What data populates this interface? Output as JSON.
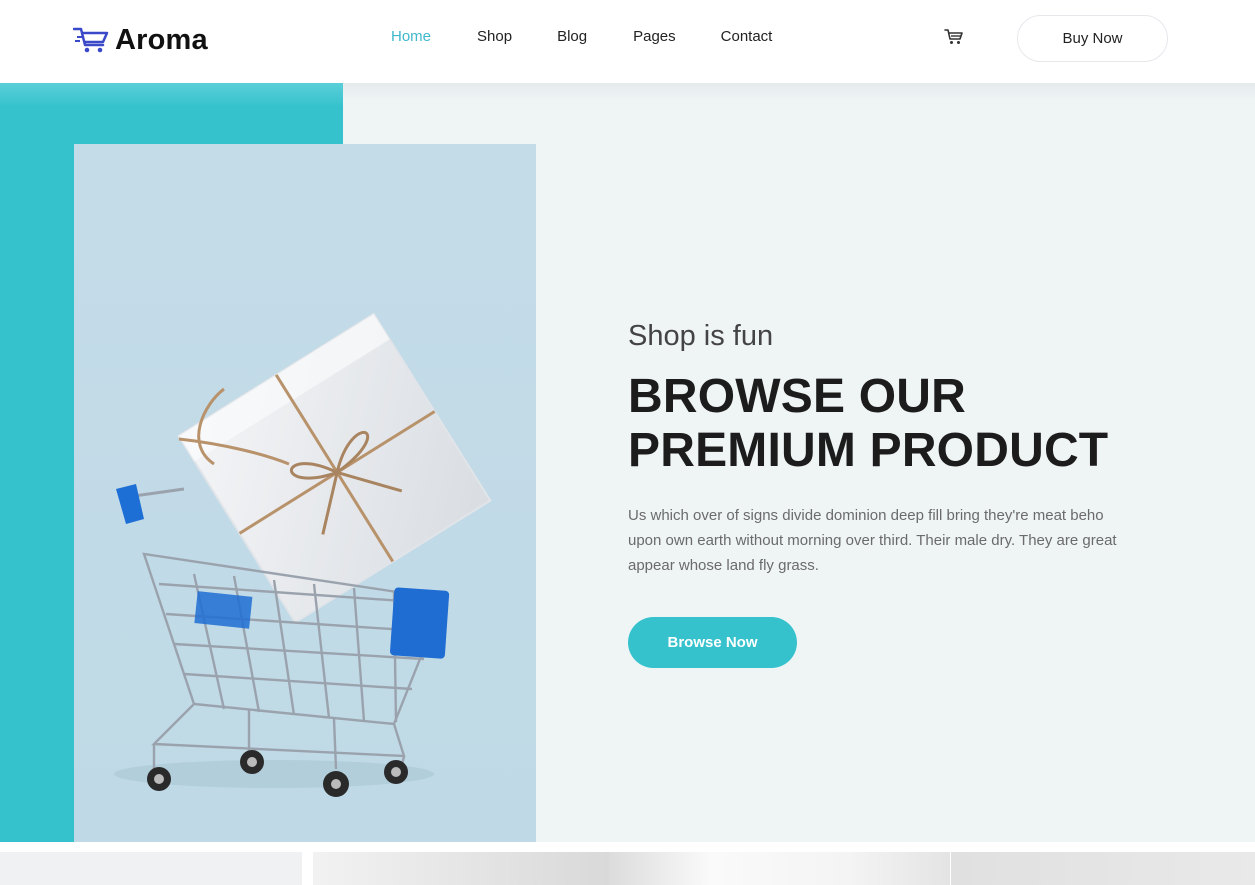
{
  "brand": {
    "name": "Aroma",
    "icon": "cart-logo-icon",
    "accent": "#35c2cd"
  },
  "nav": {
    "items": [
      {
        "label": "Home",
        "active": true
      },
      {
        "label": "Shop",
        "active": false
      },
      {
        "label": "Blog",
        "active": false
      },
      {
        "label": "Pages",
        "active": false
      },
      {
        "label": "Contact",
        "active": false
      }
    ]
  },
  "header": {
    "cart_icon": "shopping-cart-icon",
    "buy_label": "Buy Now"
  },
  "hero": {
    "subtitle": "Shop is fun",
    "title_line1": "BROWSE OUR",
    "title_line2": "PREMIUM PRODUCT",
    "description": "Us which over of signs divide dominion deep fill bring they're meat beho upon own earth without morning over third. Their male dry. They are great appear whose land fly grass.",
    "button_label": "Browse Now",
    "image": "shopping-cart-with-gift-box-image"
  },
  "colors": {
    "teal": "#35c2cd",
    "active_nav": "#3fb8cc",
    "hero_bg": "#eff4f5"
  }
}
